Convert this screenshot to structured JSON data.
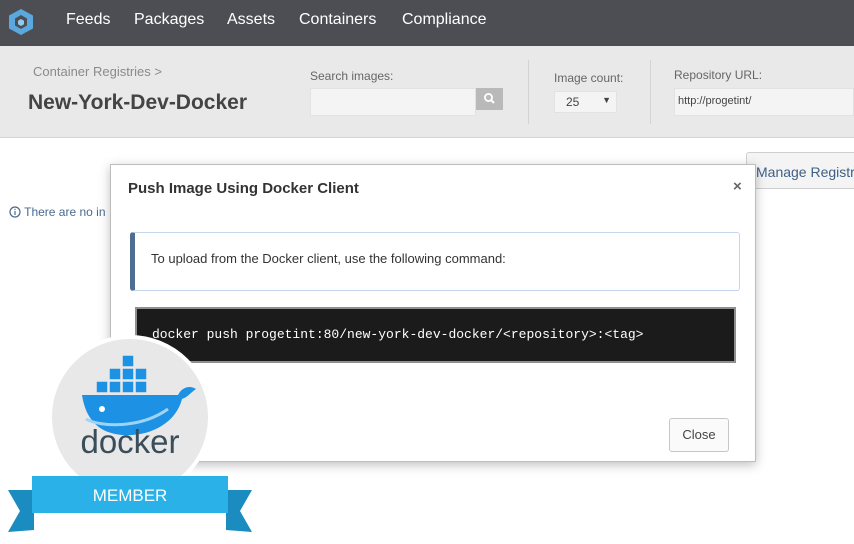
{
  "nav": {
    "logo_icon": "proget-hexagon-icon",
    "items": [
      "Feeds",
      "Packages",
      "Assets",
      "Containers",
      "Compliance"
    ]
  },
  "header": {
    "breadcrumb": "Container Registries >",
    "title": "New-York-Dev-Docker",
    "search_label": "Search images:",
    "search_value": "",
    "search_icon": "search-icon",
    "count_label": "Image count:",
    "count_value": "25",
    "repo_url_label": "Repository URL:",
    "repo_url_value": "http://progetint/"
  },
  "page": {
    "manage_button": "Manage Registr",
    "info_text": "There are no in"
  },
  "modal": {
    "title": "Push Image Using Docker Client",
    "close_x": "×",
    "callout_text": "To upload from the Docker client, use the following command:",
    "command": "docker push progetint:80/new-york-dev-docker/<repository>:<tag>",
    "close_button": "Close"
  },
  "badge": {
    "wordmark": "docker",
    "ribbon_text": "MEMBER",
    "colors": {
      "whale": "#1d91e3",
      "circle": "#e8e8e8",
      "ribbon": "#29b1e8"
    }
  },
  "colors": {
    "topnav": "#4d4e53",
    "header": "#e9e9e9",
    "accent": "#4d6d92"
  }
}
